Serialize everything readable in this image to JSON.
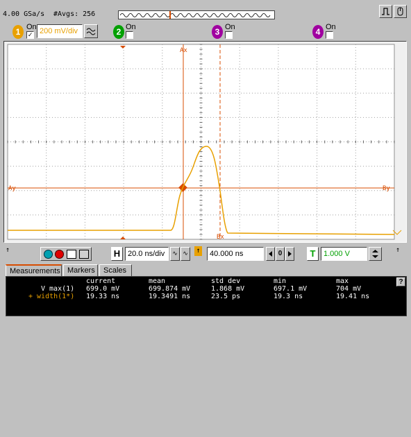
{
  "header": {
    "sample_rate": "4.00 GSa/s",
    "averages": "#Avgs: 256"
  },
  "channels": [
    {
      "num": "1",
      "on_label": "On",
      "checked": true,
      "scale": "200 mV/div",
      "color": "#e8a000",
      "text_color": "#fff"
    },
    {
      "num": "2",
      "on_label": "On",
      "checked": false,
      "color": "#00a000",
      "text_color": "#fff"
    },
    {
      "num": "3",
      "on_label": "On",
      "checked": false,
      "color": "#a000a0",
      "text_color": "#fff"
    },
    {
      "num": "4",
      "on_label": "On",
      "checked": false,
      "color": "#a000a0",
      "text_color": "#fff"
    }
  ],
  "markers": {
    "ax": "Ax",
    "bx": "Bx",
    "ay": "Ay",
    "by": "By"
  },
  "timebase": {
    "h_label": "H",
    "scale": "20.0 ns/div",
    "delay": "40.000 ns",
    "zero": "0"
  },
  "trigger": {
    "t_label": "T",
    "level": "1.000 V"
  },
  "tabs": [
    "Measurements",
    "Markers",
    "Scales"
  ],
  "measurements": {
    "headers": [
      "current",
      "mean",
      "std dev",
      "min",
      "max"
    ],
    "rows": [
      {
        "label": "V max(1)",
        "values": [
          "699.0 mV",
          "699.874 mV",
          "1.868 mV",
          "697.1 mV",
          "704 mV"
        ],
        "color": "#ffffff"
      },
      {
        "label": "+ width(1*)",
        "values": [
          "19.33 ns",
          "19.3491 ns",
          "23.5 ps",
          "19.3 ns",
          "19.41 ns"
        ],
        "color": "#e8a000"
      }
    ]
  },
  "help": "?",
  "colors": {
    "trace": "#e8a000",
    "marker": "#d84c00",
    "grid_bg": "#ffffff"
  }
}
